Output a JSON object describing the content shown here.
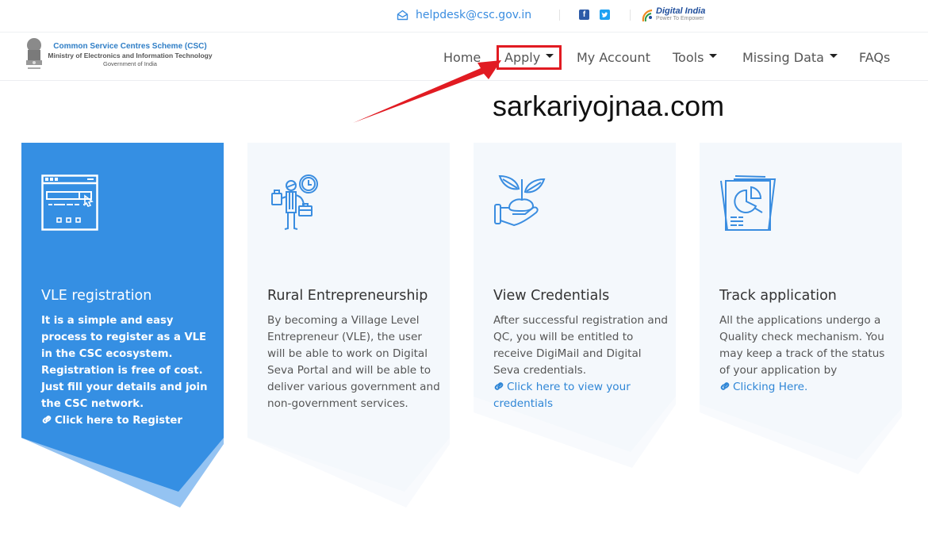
{
  "topbar": {
    "email": "helpdesk@csc.gov.in",
    "social": [
      {
        "name": "facebook",
        "glyph": "f",
        "color": "#2d5ba8"
      },
      {
        "name": "twitter",
        "glyph": "t",
        "color": "#1da1f2"
      }
    ],
    "digital_india": {
      "title": "Digital India",
      "tagline": "Power To Empower"
    }
  },
  "header": {
    "brand": {
      "line1": "Common Service Centres Scheme (CSC)",
      "line2": "Ministry of Electronics and Information Technology",
      "line3": "Government of India"
    },
    "nav": [
      {
        "label": "Home",
        "dropdown": false
      },
      {
        "label": "Apply",
        "dropdown": true,
        "highlighted": true
      },
      {
        "label": "My Account",
        "dropdown": false
      },
      {
        "label": "Tools",
        "dropdown": true
      },
      {
        "label": "Missing Data",
        "dropdown": true
      },
      {
        "label": "FAQs",
        "dropdown": false
      }
    ]
  },
  "annotation": {
    "watermark": "sarkariyojnaa.com",
    "highlight_color": "#e11b22"
  },
  "colors": {
    "accent": "#358fe3",
    "accent_light": "#94c3f2",
    "card_bg": "#f4f8fc",
    "link": "#2f86d6"
  },
  "cards": [
    {
      "icon": "browser-window-icon",
      "title": "VLE registration",
      "description": "It is a simple and easy process to register as a VLE in the CSC ecosystem. Registration is free of cost. Just fill your details and join the CSC network.",
      "link": "Click here to Register",
      "active": true
    },
    {
      "icon": "entrepreneur-icon",
      "title": "Rural Entrepreneurship",
      "description": "By becoming a Village Level Entrepreneur (VLE), the user will be able to work on Digital Seva Portal and will be able to deliver various government and non-government services.",
      "link": null,
      "active": false
    },
    {
      "icon": "plant-in-hand-icon",
      "title": "View Credentials",
      "description": "After successful registration and QC, you will be entitled to receive DigiMail and Digital Seva credentials.",
      "link": "Click here to view your credentials",
      "active": false
    },
    {
      "icon": "report-documents-icon",
      "title": "Track application",
      "description": "All the applications undergo a Quality check mechanism. You may keep a track of the status of your application by",
      "link": "Clicking Here.",
      "active": false
    }
  ]
}
